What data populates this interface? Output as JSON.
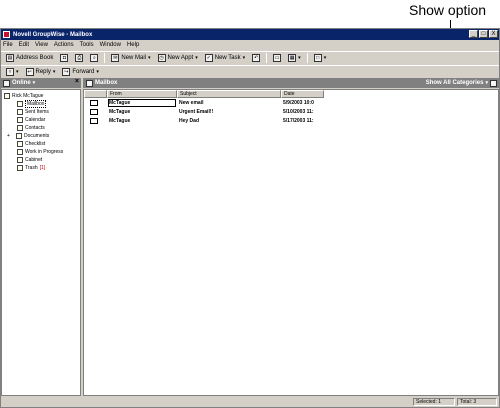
{
  "callout": {
    "label": "Show option"
  },
  "window": {
    "title": "Novell GroupWise - Mailbox",
    "controls": [
      "_",
      "□",
      "X"
    ]
  },
  "menu": [
    "File",
    "Edit",
    "View",
    "Actions",
    "Tools",
    "Window",
    "Help"
  ],
  "toolbar": {
    "address_book": "Address Book",
    "new_mail": "New Mail",
    "new_appt": "New Appt",
    "new_task": "New Task"
  },
  "toolbar2": {
    "reply": "Reply",
    "forward": "Forward"
  },
  "left_panel": {
    "header": "Online",
    "tree": {
      "root": "Rick McTague",
      "items": [
        {
          "label": "Mailbox",
          "icon": "mailbox-icon"
        },
        {
          "label": "Sent Items",
          "icon": "sent-items-icon"
        },
        {
          "label": "Calendar",
          "icon": "calendar-icon"
        },
        {
          "label": "Contacts",
          "icon": "contacts-icon"
        },
        {
          "label": "Documents",
          "icon": "documents-icon"
        },
        {
          "label": "Checklist",
          "icon": "checklist-icon"
        },
        {
          "label": "Work in Progress",
          "icon": "work-in-progress-icon"
        },
        {
          "label": "Cabinet",
          "icon": "cabinet-icon"
        },
        {
          "label": "Trash",
          "icon": "trash-icon",
          "count": "[1]"
        }
      ]
    }
  },
  "main_panel": {
    "header": "Mailbox",
    "show_option": "Show All Categories",
    "columns": [
      "From",
      "Subject",
      "Date"
    ],
    "rows": [
      {
        "from": "McTague",
        "subject": "New email",
        "date": "5/9/2003 10:0"
      },
      {
        "from": "McTague",
        "subject": "Urgent Email!!",
        "date": "5/10/2003 11:"
      },
      {
        "from": "McTague",
        "subject": "Hey Dad",
        "date": "5/17/2003 11:"
      }
    ]
  },
  "status": {
    "selected": "Selected: 1",
    "total": "Total: 3"
  }
}
